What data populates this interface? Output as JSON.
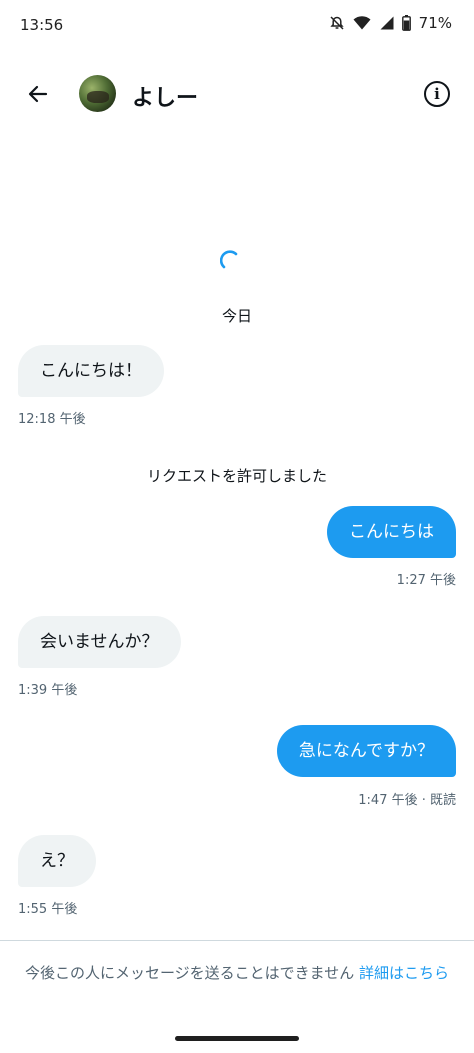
{
  "status": {
    "time": "13:56",
    "battery": "71%"
  },
  "header": {
    "name": "よしー"
  },
  "conversation": {
    "day_label": "今日",
    "system_note": "リクエストを許可しました",
    "messages": [
      {
        "text": "こんにちは！",
        "time": "12:18 午後"
      },
      {
        "text": "こんにちは",
        "time": "1:27 午後"
      },
      {
        "text": "会いませんか？",
        "time": "1:39 午後"
      },
      {
        "text": "急になんですか？",
        "time": "1:47 午後 · 既読"
      },
      {
        "text": "え？",
        "time": "1:55 午後"
      }
    ]
  },
  "footer": {
    "notice": "今後この人にメッセージを送ることはできません",
    "link": "詳細はこちら"
  },
  "colors": {
    "accent": "#1d9bf0",
    "incoming_bubble": "#eff3f4"
  }
}
